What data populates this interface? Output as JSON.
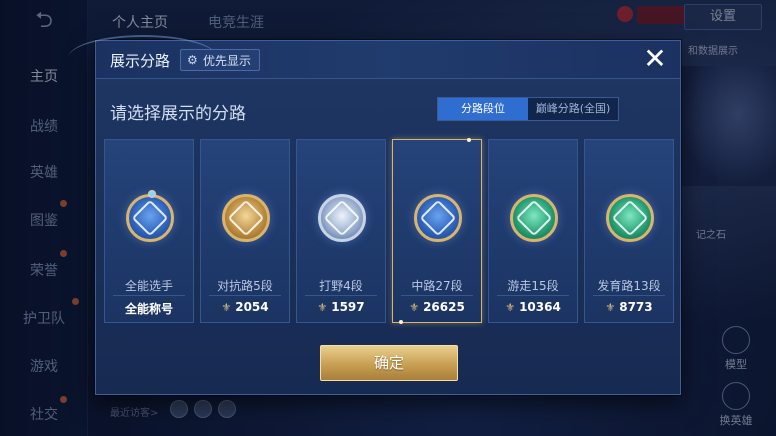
{
  "background": {
    "back_icon": "back-arrow-icon",
    "nav": [
      "主页",
      "战绩",
      "英雄",
      "图鉴",
      "荣誉",
      "护卫队",
      "游戏",
      "社交"
    ],
    "tabs": [
      "个人主页",
      "电竞生涯"
    ],
    "settings_label": "设置",
    "hint_top": "和数据展示",
    "hint_mid": "记之石",
    "model_label": "模型",
    "swap_hero_label": "换英雄",
    "recent_visitors": "最近访客>"
  },
  "dialog": {
    "title": "展示分路",
    "priority_button": "优先显示",
    "priority_icon": "gear-icon",
    "close_icon": "close-icon",
    "section_title": "请选择展示的分路",
    "toggle": {
      "option_a": "分路段位",
      "option_b": "巅峰分路(全国)",
      "selected": "分路段位"
    },
    "cards": [
      {
        "label": "全能选手",
        "value": "全能称号",
        "emblem": "all-round-emblem-icon",
        "selected": false
      },
      {
        "label": "对抗路5段",
        "value": "2054",
        "emblem": "clash-lane-emblem-icon",
        "selected": false
      },
      {
        "label": "打野4段",
        "value": "1597",
        "emblem": "jungle-emblem-icon",
        "selected": false
      },
      {
        "label": "中路27段",
        "value": "26625",
        "emblem": "mid-lane-emblem-icon",
        "selected": true
      },
      {
        "label": "游走15段",
        "value": "10364",
        "emblem": "roam-emblem-icon",
        "selected": false
      },
      {
        "label": "发育路13段",
        "value": "8773",
        "emblem": "farm-lane-emblem-icon",
        "selected": false
      }
    ],
    "value_icon": "power-icon",
    "confirm_label": "确定"
  },
  "colors": {
    "accent_blue": "#2f6dd1",
    "gold": "#d9b46f",
    "dialog_bg": "#1f3764"
  }
}
